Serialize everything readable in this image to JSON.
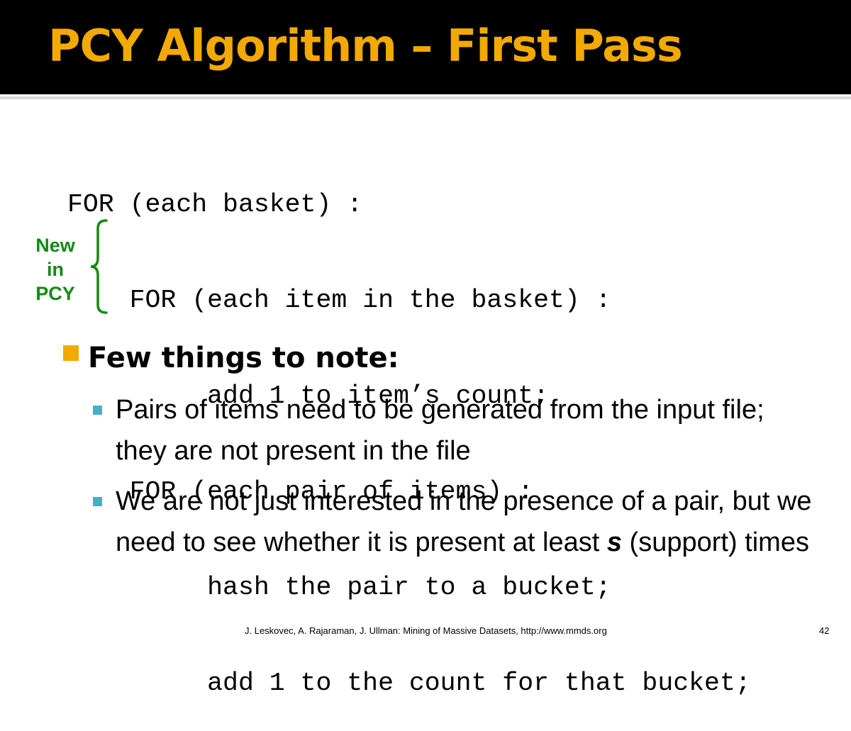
{
  "title": "PCY Algorithm – First Pass",
  "code_lines": [
    "FOR (each basket) :",
    "    FOR (each item in the basket) :",
    "         add 1 to item’s count;",
    "    FOR (each pair of items) :",
    "         hash the pair to a bucket;",
    "         add 1 to the count for that bucket;"
  ],
  "new_label": [
    "New",
    "in",
    "PCY"
  ],
  "heading": "Few things to note:",
  "notes": [
    {
      "text": "Pairs of items need to be generated from the input file; they are not present in the file"
    },
    {
      "text_before": "We are not just interested in the presence of a pair, but we need to see whether it is present at least ",
      "emphasis": "s",
      "text_after": " (support) times"
    }
  ],
  "footer": "J. Leskovec, A. Rajaraman, J. Ullman: Mining of Massive Datasets, http://www.mmds.org",
  "page_number": "42",
  "colors": {
    "title": "#f2a900",
    "title_background": "#000000",
    "new_label": "#138a13",
    "bullet_level1": "#f2a900",
    "bullet_level2": "#4bacc6"
  }
}
